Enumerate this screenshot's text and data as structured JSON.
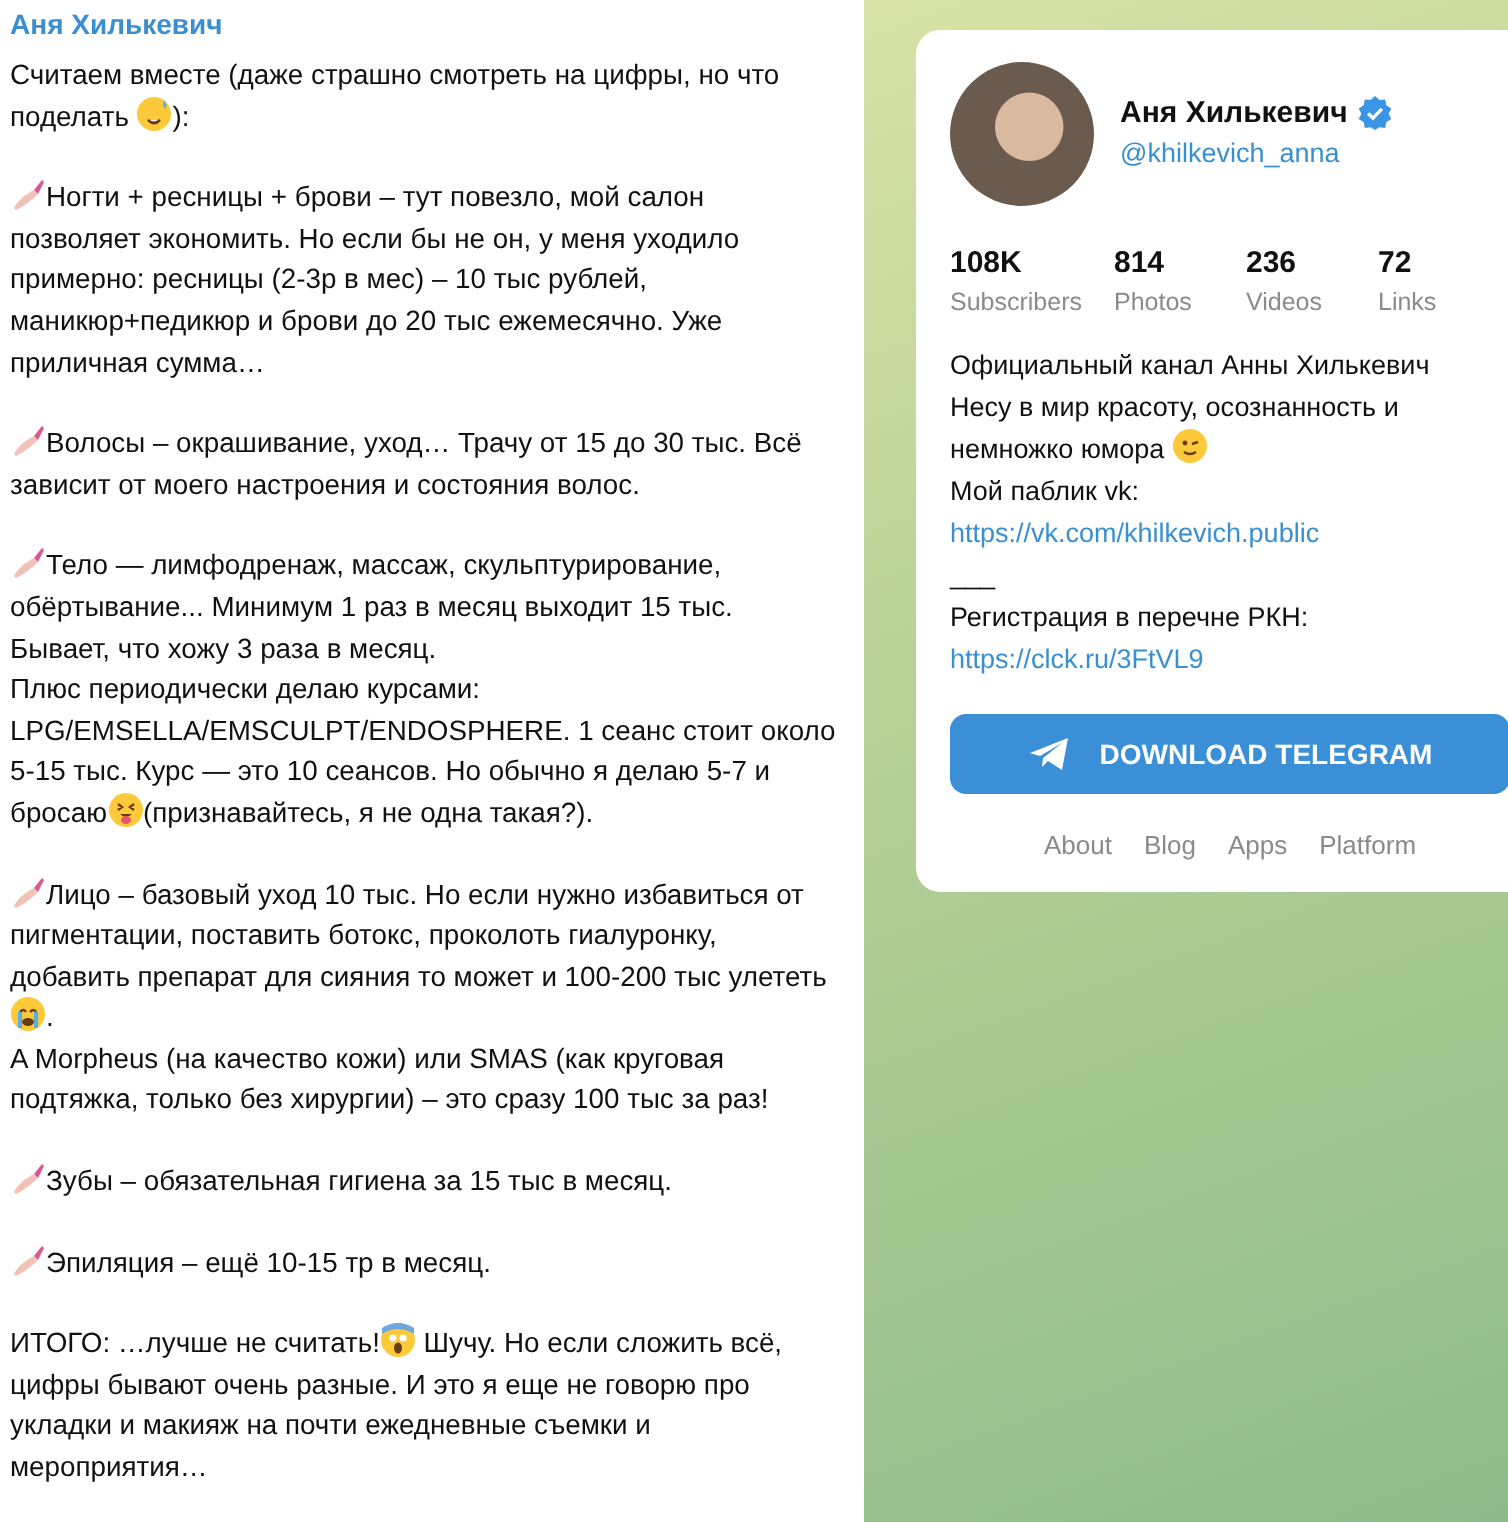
{
  "post": {
    "author": "Аня Хилькевич",
    "paragraphs": [
      [
        {
          "kind": "text",
          "text": "Считаем вместе (даже страшно смотреть на цифры, но что поделать "
        },
        {
          "kind": "sweat"
        },
        {
          "kind": "text",
          "text": "):"
        }
      ],
      [
        {
          "kind": "nails"
        },
        {
          "kind": "text",
          "text": "Ногти + ресницы + брови – тут повезло, мой салон позволяет экономить. Но если бы не он, у меня уходило примерно: ресницы (2-3р в мес) – 10 тыс рублей, маникюр+педикюр и брови до 20 тыс ежемесячно. Уже приличная сумма…"
        }
      ],
      [
        {
          "kind": "nails"
        },
        {
          "kind": "text",
          "text": "Волосы – окрашивание, уход… Трачу от 15 до 30 тыс. Всё зависит от моего настроения и состояния волос."
        }
      ],
      [
        {
          "kind": "nails"
        },
        {
          "kind": "text",
          "text": "Тело — лимфодренаж, массаж, скульптурирование, обёртывание... Минимум 1 раз в месяц выходит 15 тыс. Бывает, что хожу 3 раза в месяц.\nПлюс периодически делаю курсами: LPG/EMSELLA/EMSCULPT/ENDOSPHERE. 1 сеанс стоит около 5-15 тыс. Курс — это 10 сеансов. Но обычно я делаю 5-7 и бросаю"
        },
        {
          "kind": "tongue"
        },
        {
          "kind": "text",
          "text": "(признавайтесь, я не одна такая?)."
        }
      ],
      [
        {
          "kind": "nails"
        },
        {
          "kind": "text",
          "text": "Лицо – базовый уход 10 тыс. Но если нужно избавиться от пигментации, поставить ботокс, проколоть гиалуронку, добавить препарат для сияния то может и 100-200 тыс улететь "
        },
        {
          "kind": "cry"
        },
        {
          "kind": "text",
          "text": ".\nA Morpheus (на качество кожи) или SMAS (как круговая подтяжка, только без хирургии) – это сразу 100 тыс за раз!"
        }
      ],
      [
        {
          "kind": "nails"
        },
        {
          "kind": "text",
          "text": "Зубы – обязательная гигиена за 15 тыс в месяц."
        }
      ],
      [
        {
          "kind": "nails"
        },
        {
          "kind": "text",
          "text": "Эпиляция – ещё 10-15 тр в месяц."
        }
      ],
      [
        {
          "kind": "text",
          "text": "ИТОГО: …лучше не считать!"
        },
        {
          "kind": "scream"
        },
        {
          "kind": "text",
          "text": " Шучу. Но если сложить всё, цифры бывают очень разные. И это я еще не говорю про укладки и макияж на почти ежедневные съемки и мероприятия…"
        }
      ]
    ]
  },
  "channel": {
    "name": "Аня Хилькевич",
    "verified": true,
    "handle": "@khilkevich_anna",
    "stats": [
      {
        "value": "108K",
        "label": "Subscribers"
      },
      {
        "value": "814",
        "label": "Photos"
      },
      {
        "value": "236",
        "label": "Videos"
      },
      {
        "value": "72",
        "label": "Links"
      }
    ],
    "description": [
      {
        "kind": "text",
        "text": "Официальный канал Анны Хилькевич"
      },
      {
        "kind": "text",
        "text": "Несу в мир красоту, осознанность и"
      },
      {
        "kind": "wink",
        "text": "немножко юмора "
      },
      {
        "kind": "text",
        "text": "Мой паблик vk:"
      },
      {
        "kind": "link",
        "text": "https://vk.com/khilkevich.public"
      },
      {
        "kind": "text",
        "text": "___"
      },
      {
        "kind": "text",
        "text": "Регистрация в перечне РКН:"
      },
      {
        "kind": "link",
        "text": "https://clck.ru/3FtVL9"
      }
    ],
    "download_button": "DOWNLOAD TELEGRAM",
    "footer_links": [
      "About",
      "Blog",
      "Apps",
      "Platform"
    ]
  }
}
